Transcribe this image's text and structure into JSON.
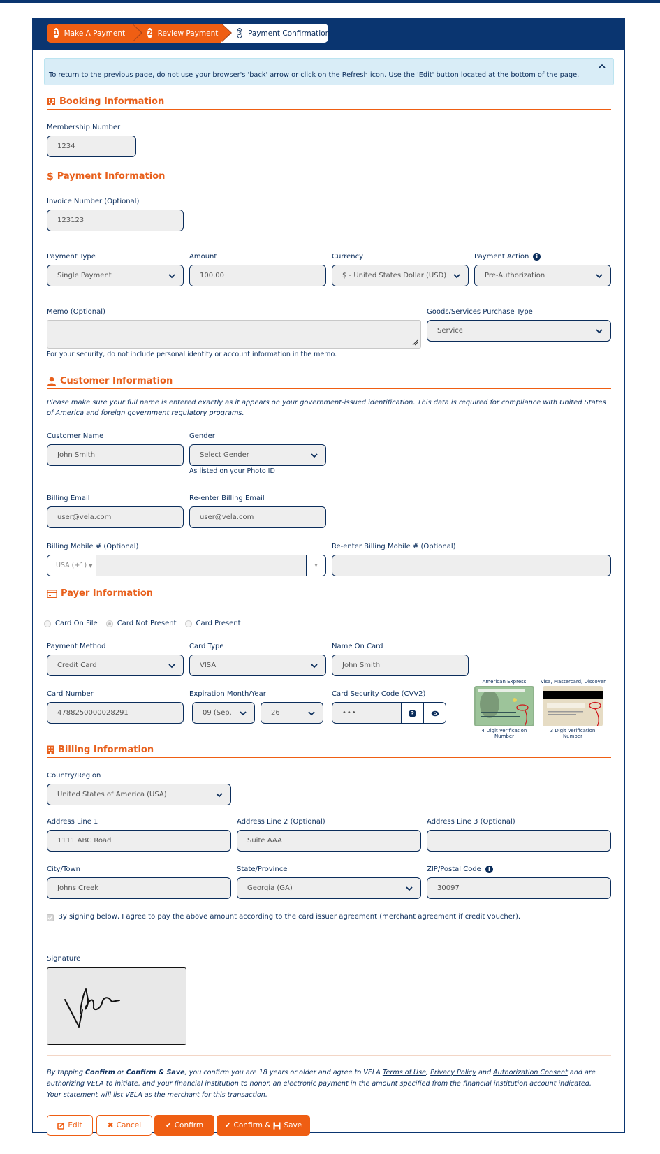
{
  "steps": [
    {
      "number": "1",
      "label": "Make A Payment",
      "state": "done"
    },
    {
      "number": "2",
      "label": "Review Payment",
      "state": "done"
    },
    {
      "number": "3",
      "label": "Payment Confirmation",
      "state": "current"
    }
  ],
  "alert": {
    "text": "To return to the previous page, do not use your browser's 'back' arrow or click on the Refresh icon. Use the 'Edit' button located at the bottom of the page.",
    "collapse_icon": "chevron-up-icon"
  },
  "booking": {
    "title": "Booking Information",
    "icon": "hotel-icon",
    "membership_label": "Membership Number",
    "membership_value": "1234"
  },
  "payment": {
    "title": "Payment Information",
    "icon": "dollar-icon",
    "invoice_label": "Invoice Number (Optional)",
    "invoice_value": "123123",
    "payment_type_label": "Payment Type",
    "payment_type_value": "Single Payment",
    "amount_label": "Amount",
    "amount_value": "100.00",
    "currency_label": "Currency",
    "currency_value": "$ - United States Dollar (USD)",
    "payment_action_label": "Payment Action",
    "payment_action_value": "Pre-Authorization",
    "memo_label": "Memo (Optional)",
    "memo_value": "",
    "memo_help": "For your security, do not include personal identity or account information in the memo.",
    "purchase_type_label": "Goods/Services Purchase Type",
    "purchase_type_value": "Service"
  },
  "customer": {
    "title": "Customer Information",
    "icon": "user-icon",
    "note": "Please make sure your full name is entered exactly as it appears on your government-issued identification. This data is required for compliance with United States of America and foreign government regulatory programs.",
    "name_label": "Customer Name",
    "name_value": "John Smith",
    "gender_label": "Gender",
    "gender_value": "Select Gender",
    "gender_help": "As listed on your Photo ID",
    "email_label": "Billing Email",
    "email_value": "user@vela.com",
    "email2_label": "Re-enter Billing Email",
    "email2_value": "user@vela.com",
    "mobile_label": "Billing Mobile # (Optional)",
    "mobile_country": "USA (+1)",
    "mobile_value": "",
    "mobile2_label": "Re-enter Billing Mobile # (Optional)",
    "mobile2_value": ""
  },
  "payer": {
    "title": "Payer Information",
    "icon": "credit-card-icon",
    "radios": [
      {
        "label": "Card On File",
        "checked": false
      },
      {
        "label": "Card Not Present",
        "checked": true
      },
      {
        "label": "Card Present",
        "checked": false
      }
    ],
    "method_label": "Payment Method",
    "method_value": "Credit Card",
    "card_type_label": "Card Type",
    "card_type_value": "VISA",
    "name_on_card_label": "Name On Card",
    "name_on_card_value": "John Smith",
    "card_number_label": "Card Number",
    "card_number_value": "4788250000028291",
    "expiration_label": "Expiration Month/Year",
    "exp_month_value": "09 (Sep.",
    "exp_year_value": "26",
    "cvv_label": "Card Security Code (CVV2)",
    "cvv_value": "•••",
    "amex_caption": "American Express",
    "amex_note": "4 Digit Verification Number",
    "visa_caption": "Visa, Mastercard, Discover",
    "visa_note": "3 Digit Verification Number"
  },
  "billing": {
    "title": "Billing Information",
    "icon": "building-icon",
    "country_label": "Country/Region",
    "country_value": "United States of America (USA)",
    "address1_label": "Address Line 1",
    "address1_value": "1111 ABC Road",
    "address2_label": "Address Line 2 (Optional)",
    "address2_value": "Suite AAA",
    "address3_label": "Address Line 3 (Optional)",
    "address3_value": "",
    "city_label": "City/Town",
    "city_value": "Johns Creek",
    "state_label": "State/Province",
    "state_value": "Georgia (GA)",
    "zip_label": "ZIP/Postal Code",
    "zip_value": "30097",
    "agree_text": "By signing below, I agree to pay the above amount according to the card issuer agreement (merchant agreement if credit voucher).",
    "agree_checked": true,
    "signature_label": "Signature"
  },
  "terms": {
    "p1": "By tapping ",
    "confirm": "Confirm",
    "or": " or ",
    "confirm_save": "Confirm & Save",
    "p2": ", you confirm you are 18 years or older and agree to VELA ",
    "terms_link": "Terms of Use",
    "comma": ", ",
    "privacy_link": "Privacy Policy",
    "and": " and ",
    "auth_link": "Authorization Consent",
    "p3": " and are authorizing VELA to initiate, and your financial institution to honor, an electronic payment in the amount specified from the financial institution account indicated. Your statement will list VELA as the merchant for this transaction."
  },
  "buttons": {
    "edit": "Edit",
    "cancel": "Cancel",
    "confirm": "Confirm",
    "confirm_and": "Confirm &",
    "save": "Save"
  },
  "colors": {
    "brand_navy": "#0a3570",
    "accent_orange": "#ef5e13",
    "alert_bg": "#d9edf7",
    "field_bg": "#eeeeee"
  }
}
